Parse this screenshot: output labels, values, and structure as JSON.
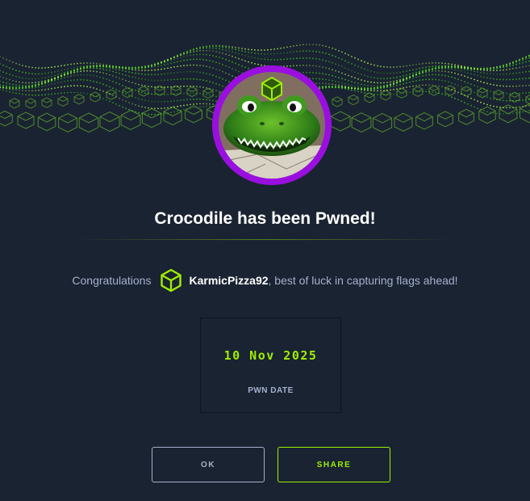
{
  "machine": {
    "title": "Crocodile has been Pwned!"
  },
  "congrats": {
    "prefix": "Congratulations",
    "username": "KarmicPizza92",
    "suffix": ", best of luck in capturing flags ahead!"
  },
  "pwn": {
    "date": "10 Nov 2025",
    "label": "PWN DATE"
  },
  "buttons": {
    "ok": "OK",
    "share": "SHARE"
  },
  "colors": {
    "background": "#1a2332",
    "accent": "#9fef00",
    "avatar_ring": "#9a0fe0",
    "muted_text": "#a4b1cd"
  },
  "icons": {
    "user_badge": "hexagon-cube-icon",
    "avatar_badge": "hexagon-cube-icon",
    "banner": "green-cube-wave-decoration"
  }
}
